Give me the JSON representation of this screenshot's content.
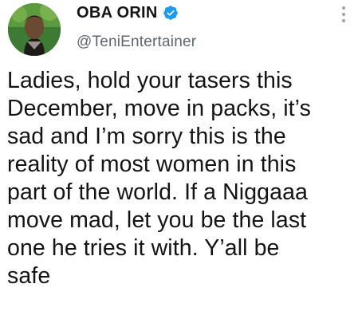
{
  "author": {
    "display_name": "OBA ORIN",
    "handle": "@TeniEntertainer",
    "verified": true
  },
  "icons": {
    "verified": "verified-badge-icon",
    "more": "more-vertical-icon"
  },
  "colors": {
    "verified_blue": "#1d9bf0",
    "handle_gray": "#5b6670",
    "text": "#141414"
  },
  "tweet": {
    "text": "Ladies, hold your tasers this\nDecember, move in packs, it’s\nsad and I’m sorry this is the\nreality of most women in this\npart of the world. If a Niggaaa\nmove mad, let you be the last\none  he tries it with. Y’all be\nsafe"
  }
}
